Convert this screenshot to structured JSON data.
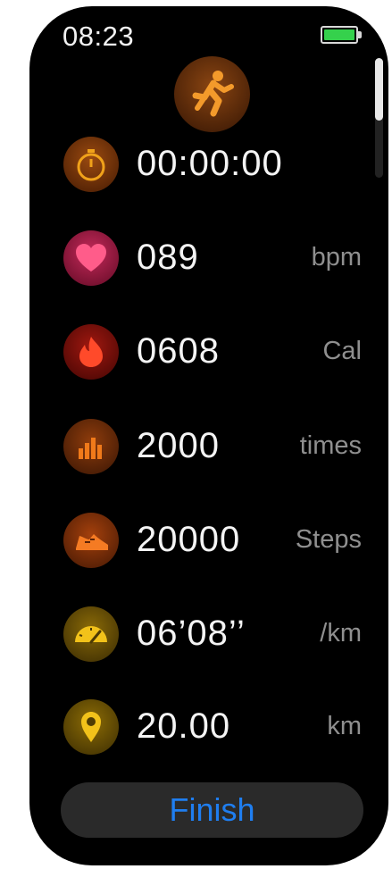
{
  "status": {
    "time": "08:23",
    "battery_color": "#35d14c"
  },
  "sport": {
    "icon": "running-icon",
    "color": "#f39a2b"
  },
  "metrics": [
    {
      "icon": "stopwatch-icon",
      "value": "00:00:00",
      "unit": ""
    },
    {
      "icon": "heart-icon",
      "value": "089",
      "unit": "bpm"
    },
    {
      "icon": "flame-icon",
      "value": "0608",
      "unit": "Cal"
    },
    {
      "icon": "bar-chart-icon",
      "value": "2000",
      "unit": "times"
    },
    {
      "icon": "shoe-icon",
      "value": "20000",
      "unit": "Steps"
    },
    {
      "icon": "speedometer-icon",
      "value": "06’08’’",
      "unit": "/km"
    },
    {
      "icon": "location-pin-icon",
      "value": "20.00",
      "unit": "km"
    }
  ],
  "finish_button": {
    "label": "Finish",
    "color": "#1f7ef0"
  }
}
